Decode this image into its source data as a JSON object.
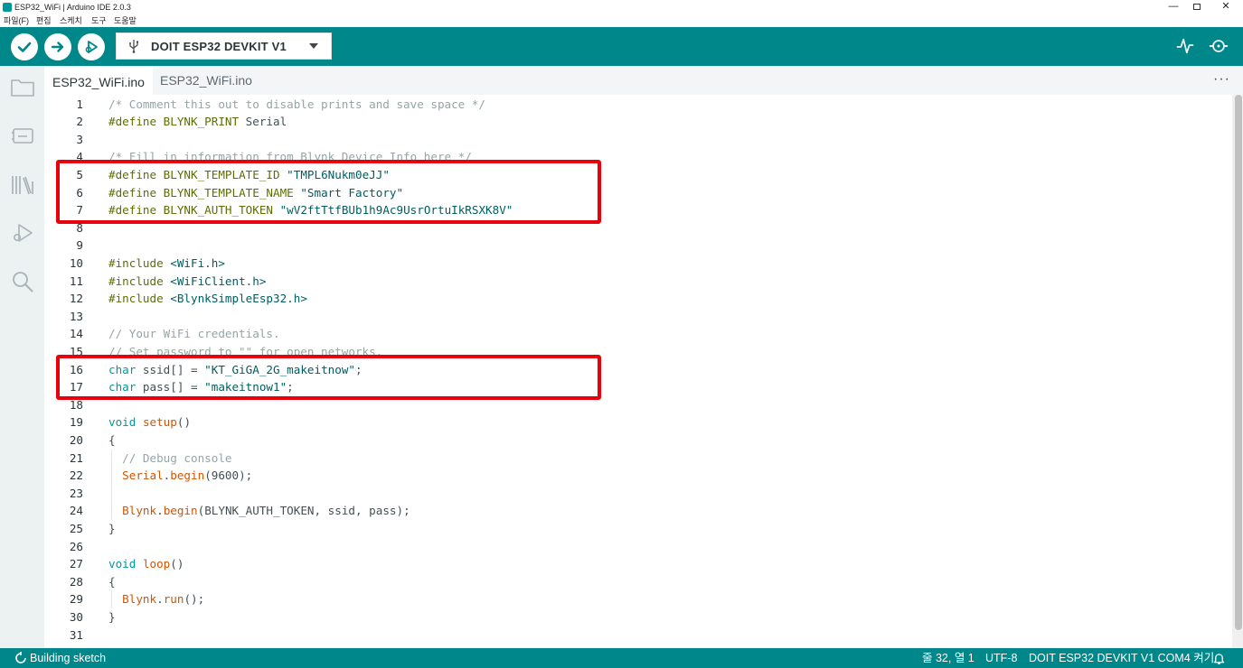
{
  "window": {
    "title": "ESP32_WiFi | Arduino IDE 2.0.3",
    "minimize": "—",
    "close": "✕"
  },
  "menu": [
    "파일(F)",
    "편집",
    "스케치",
    "도구",
    "도움말"
  ],
  "toolbar": {
    "verify_icon": "check-icon",
    "upload_icon": "arrow-right-icon",
    "debug_icon": "debug-play-icon",
    "board": "DOIT ESP32 DEVKIT V1",
    "plotter_icon": "pulse-icon",
    "monitor_icon": "serial-monitor-icon",
    "accent": "#00878a"
  },
  "tabs": [
    {
      "label": "ESP32_WiFi.ino",
      "active": true
    },
    {
      "label": "ESP32_WiFi.ino",
      "active": false
    }
  ],
  "tabs_more": "···",
  "editor": {
    "line_numbers": [
      "1",
      "2",
      "3",
      "4",
      "5",
      "6",
      "7",
      "8",
      "9",
      "10",
      "11",
      "12",
      "13",
      "14",
      "15",
      "16",
      "17",
      "18",
      "19",
      "20",
      "21",
      "22",
      "23",
      "24",
      "25",
      "26",
      "27",
      "28",
      "29",
      "30",
      "31"
    ],
    "lines": [
      "/* Comment this out to disable prints and save space */",
      "#define BLYNK_PRINT Serial",
      "",
      "/* Fill in information from Blynk Device Info here */",
      "#define BLYNK_TEMPLATE_ID \"TMPL6Nukm0eJJ\"",
      "#define BLYNK_TEMPLATE_NAME \"Smart Factory\"",
      "#define BLYNK_AUTH_TOKEN \"wV2ftTtfBUb1h9Ac9UsrOrtuIkRSXK8V\"",
      "",
      "",
      "#include <WiFi.h>",
      "#include <WiFiClient.h>",
      "#include <BlynkSimpleEsp32.h>",
      "",
      "// Your WiFi credentials.",
      "// Set password to \"\" for open networks.",
      "char ssid[] = \"KT_GiGA_2G_makeitnow\";",
      "char pass[] = \"makeitnow1\";",
      "",
      "void setup()",
      "{",
      "  // Debug console",
      "  Serial.begin(9600);",
      "",
      "  Blynk.begin(BLYNK_AUTH_TOKEN, ssid, pass);",
      "}",
      "",
      "void loop()",
      "{",
      "  Blynk.run();",
      "}",
      ""
    ],
    "highlight_color": "#e8000b"
  },
  "status": {
    "left": "Building sketch",
    "position": "줄 32, 열 1",
    "encoding": "UTF-8",
    "board_port": "DOIT ESP32 DEVKIT V1 COM4 켜기",
    "bell_icon": "bell-icon"
  }
}
